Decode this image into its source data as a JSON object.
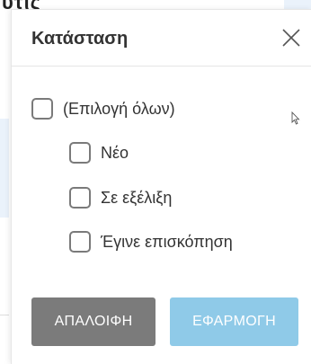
{
  "background": {
    "partial_text": "υτις"
  },
  "filter_popup": {
    "title": "Κατάσταση",
    "close_icon": "close-icon",
    "select_all_label": "(Επιλογή όλων)",
    "options": [
      {
        "label": "Νέο",
        "checked": false
      },
      {
        "label": "Σε εξέλιξη",
        "checked": false
      },
      {
        "label": "Έγινε επισκόπηση",
        "checked": false
      }
    ],
    "select_all_checked": false,
    "clear_button_label": "ΑΠΑΛΟΙΦΗ",
    "apply_button_label": "ΕΦΑΡΜΟΓΗ"
  },
  "colors": {
    "clear_button_bg": "#7b7b7b",
    "apply_button_bg": "#8fcae8",
    "checkbox_border": "#7a7a7a",
    "title_text": "#333333"
  }
}
